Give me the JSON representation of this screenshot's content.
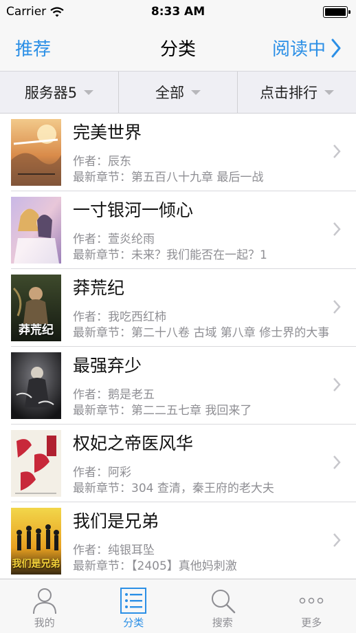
{
  "status": {
    "carrier": "Carrier",
    "time": "8:33 AM",
    "wifi_icon": "wifi-icon",
    "battery_icon": "battery-icon"
  },
  "nav": {
    "left": "推荐",
    "title": "分类",
    "right": "阅读中",
    "right_icon": "chevron-right-icon"
  },
  "filters": [
    "服务器5",
    "全部",
    "点击排行"
  ],
  "colors": {
    "accent": "#2b8fe6",
    "secondary_text": "#8e8e93",
    "bar_bg": "#f7f7f7",
    "filter_bg": "#efeff4"
  },
  "books": [
    {
      "title": "完美世界",
      "author": "作者：辰东",
      "latest": "最新章节：第五百八十九章 最后一战"
    },
    {
      "title": "一寸银河一倾心",
      "author": "作者：萱炎纶雨",
      "latest": "最新章节：未来？我们能否在一起？1"
    },
    {
      "title": "莽荒纪",
      "author": "作者：我吃西红柿",
      "latest": "最新章节：第二十八卷 古域 第八章 修士界的大事",
      "cover_text": "莽荒纪"
    },
    {
      "title": "最强弃少",
      "author": "作者：鹅是老五",
      "latest": "最新章节：第二二五七章 我回来了"
    },
    {
      "title": "权妃之帝医风华",
      "author": "作者：阿彩",
      "latest": "最新章节：304 查清，秦王府的老大夫"
    },
    {
      "title": "我们是兄弟",
      "author": "作者：纯银耳坠",
      "latest": "最新章节：【2405】真他妈刺激",
      "cover_text": "我们是兄弟"
    }
  ],
  "tabs": [
    {
      "label": "我的",
      "icon": "person-icon"
    },
    {
      "label": "分类",
      "icon": "list-icon",
      "active": true
    },
    {
      "label": "搜索",
      "icon": "search-icon"
    },
    {
      "label": "更多",
      "icon": "more-icon"
    }
  ]
}
